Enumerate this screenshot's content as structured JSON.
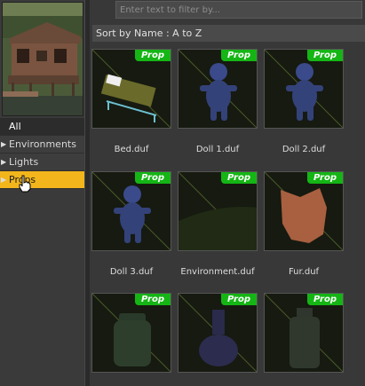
{
  "sidebar": {
    "categories": [
      {
        "label": "All",
        "arrow": ""
      },
      {
        "label": "Environments",
        "arrow": "▶"
      },
      {
        "label": "Lights",
        "arrow": "▶"
      },
      {
        "label": "Props",
        "arrow": "▶"
      }
    ],
    "selected": "Props"
  },
  "filter": {
    "placeholder": "Enter text to filter by..."
  },
  "sort": {
    "label": "Sort by Name : A to Z"
  },
  "items": [
    {
      "name": "Bed.duf",
      "badge": "Prop",
      "icon": "bed-icon"
    },
    {
      "name": "Doll 1.duf",
      "badge": "Prop",
      "icon": "doll-icon"
    },
    {
      "name": "Doll 2.duf",
      "badge": "Prop",
      "icon": "doll-icon"
    },
    {
      "name": "Doll 3.duf",
      "badge": "Prop",
      "icon": "doll-icon"
    },
    {
      "name": "Environment.duf",
      "badge": "Prop",
      "icon": "environment-icon"
    },
    {
      "name": "Fur.duf",
      "badge": "Prop",
      "icon": "fur-icon"
    },
    {
      "name": "",
      "badge": "Prop",
      "icon": "jar-icon"
    },
    {
      "name": "",
      "badge": "Prop",
      "icon": "flask-icon"
    },
    {
      "name": "",
      "badge": "Prop",
      "icon": "bottle-icon"
    }
  ],
  "colors": {
    "accent": "#f2b61c",
    "badge": "#15b515"
  }
}
